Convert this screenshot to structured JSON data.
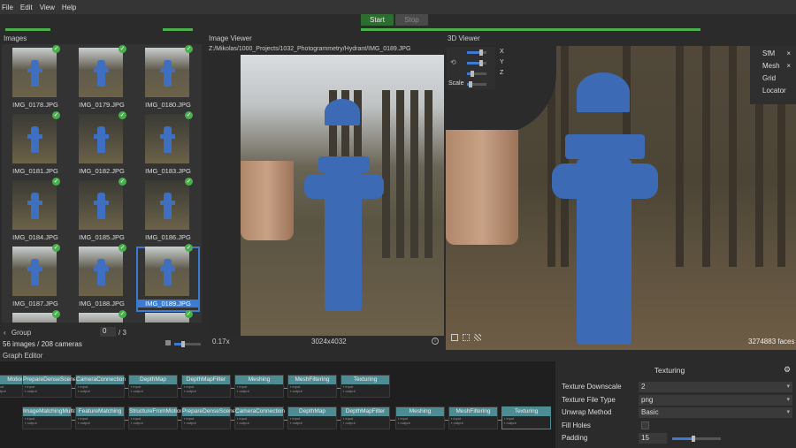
{
  "menu": [
    "File",
    "Edit",
    "View",
    "Help"
  ],
  "toolbar": {
    "start": "Start",
    "stop": "Stop"
  },
  "images_panel": {
    "title": "Images",
    "thumbnails": [
      "IMG_0178.JPG",
      "IMG_0179.JPG",
      "IMG_0180.JPG",
      "IMG_0181.JPG",
      "IMG_0182.JPG",
      "IMG_0183.JPG",
      "IMG_0184.JPG",
      "IMG_0185.JPG",
      "IMG_0186.JPG",
      "IMG_0187.JPG",
      "IMG_0188.JPG",
      "IMG_0189.JPG"
    ],
    "selected": "IMG_0189.JPG",
    "group_label": "Group",
    "group_value": "0",
    "group_total": "/ 3",
    "count": "56 images / 208 cameras"
  },
  "image_viewer": {
    "title": "Image Viewer",
    "path": "Z:/Mikolas/1000_Projects/1032_Photogrammetry/Hydrant/IMG_0189.JPG",
    "zoom": "0.17x",
    "resolution": "3024x4032"
  },
  "viewer_3d": {
    "title": "3D Viewer",
    "axes": [
      "X",
      "Y",
      "Z"
    ],
    "scale_label": "Scale",
    "layers": [
      "SfM",
      "Mesh",
      "Grid",
      "Locator"
    ],
    "faces": "3274883 faces"
  },
  "graph_editor": {
    "title": "Graph Editor",
    "row1": [
      "Motion",
      "PrepareDenseScene",
      "CameraConnection",
      "DepthMap",
      "DepthMapFilter",
      "Meshing",
      "MeshFiltering",
      "Texturing"
    ],
    "row2": [
      "ImageMatchingMultiSfM",
      "FeatureMatching",
      "StructureFromMotion",
      "PrepareDenseScene",
      "CameraConnection",
      "DepthMap",
      "DepthMapFilter",
      "Meshing",
      "MeshFiltering",
      "Texturing"
    ]
  },
  "properties": {
    "title": "Texturing",
    "rows": [
      {
        "key": "Texture Downscale",
        "value": "2"
      },
      {
        "key": "Texture File Type",
        "value": "png"
      },
      {
        "key": "Unwrap Method",
        "value": "Basic"
      },
      {
        "key": "Fill Holes",
        "value": ""
      },
      {
        "key": "Padding",
        "value": "15"
      }
    ]
  },
  "colors": {
    "accent": "#3d7ad1",
    "start": "#2d6d2f",
    "node": "#4e8c94",
    "check": "#47b04a"
  }
}
